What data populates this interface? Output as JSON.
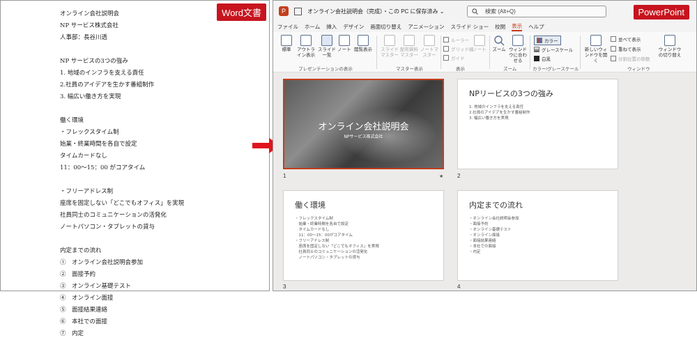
{
  "word": {
    "badge": "Word文書",
    "lines": [
      "オンライン会社説明会",
      "NP サービス株式会社",
      "人事部：長谷川透",
      "",
      "NP サービスの3つの強み",
      "1. 地域のインフラを支える責任",
      "2.社員のアイデアを生かす番組制作",
      "3. 幅広い働き方を実現",
      "",
      "働く環境",
      "・フレックスタイム制",
      "始業・終業時間を各自で設定",
      "タイムカードなし",
      "11：00～15：00 がコアタイム",
      "",
      "・フリーアドレス制",
      "座席を固定しない「どこでもオフィス」を実現",
      "社員同士のコミュニケーションの活発化",
      "ノートパソコン・タブレットの貸与",
      "",
      "内定までの流れ",
      "①　オンライン会社説明会参加",
      "②　面接予約",
      "③　オンライン基礎テスト",
      "④　オンライン面接",
      "⑤　面接結果連絡",
      "⑥　本社での面接",
      "⑦　内定"
    ]
  },
  "powerpoint": {
    "badge": "PowerPoint",
    "title_text": "オンライン会社説明会（完成）・この PC に保存済み ⌄",
    "search_placeholder": "検索 (Alt+Q)",
    "menu": [
      "ファイル",
      "ホーム",
      "挿入",
      "デザイン",
      "画面切り替え",
      "アニメーション",
      "スライド ショー",
      "校閲",
      "表示",
      "ヘルプ"
    ],
    "active_menu": "表示",
    "ribbon": {
      "view_normal": "標準",
      "view_outline": "アウトライン表示",
      "view_sorter": "スライド一覧",
      "view_notes": "ノート",
      "view_reading": "閲覧表示",
      "group_presentation_views": "プレゼンテーションの表示",
      "master_slide": "スライドマスター",
      "master_handout": "配布資料マスター",
      "master_notes": "ノートマスター",
      "group_master_views": "マスター表示",
      "show_ruler": "ルーラー",
      "show_grid": "グリッド線",
      "show_guides": "ガイド",
      "show_notes": "ノート",
      "group_show": "表示",
      "zoom": "ズーム",
      "fit_window": "ウィンドウに合わせる",
      "group_zoom": "ズーム",
      "color": "カラー",
      "grayscale": "グレースケール",
      "bw": "白黒",
      "group_color": "カラー/グレースケール",
      "new_window": "新しいウィンドウを開く",
      "arrange_all": "並べて表示",
      "cascade": "重ねて表示",
      "move_split": "分割位置の移動",
      "switch_windows": "ウィンドウの切り替え",
      "group_window": "ウィンドウ"
    },
    "slides": [
      {
        "num": "1",
        "title": "オンライン会社説明会",
        "subtitle": "NPサービス株式会社"
      },
      {
        "num": "2",
        "title": "NPリービスの3つの強み",
        "body": [
          "1. 地域のインフラを支える責任",
          "2.社員のアイデアを生かす番組制作",
          "3. 幅広い働き方を実現"
        ]
      },
      {
        "num": "3",
        "title": "働く環境",
        "body": [
          "・フレックスタイム制",
          "　始業・終業時間を各自で設定",
          "　タイムカードなし",
          "　11：00～15：00がコアタイム",
          "・フリーアドレス制",
          "　座席を固定しない「どこでもオフィス」を実現",
          "　社員同士のコミュニケーションの活発化",
          "　ノートパソコン・タブレットの貸与"
        ]
      },
      {
        "num": "4",
        "title": "内定までの流れ",
        "body": [
          "・オンライン会社説明会参加",
          "・面接予約",
          "・オンライン基礎テスト",
          "・オンライン面接",
          "・面接結果連絡",
          "・本社での面接",
          "・内定"
        ]
      }
    ],
    "colors": {
      "accent": "#c43e1c",
      "badge": "#c7141e"
    }
  }
}
